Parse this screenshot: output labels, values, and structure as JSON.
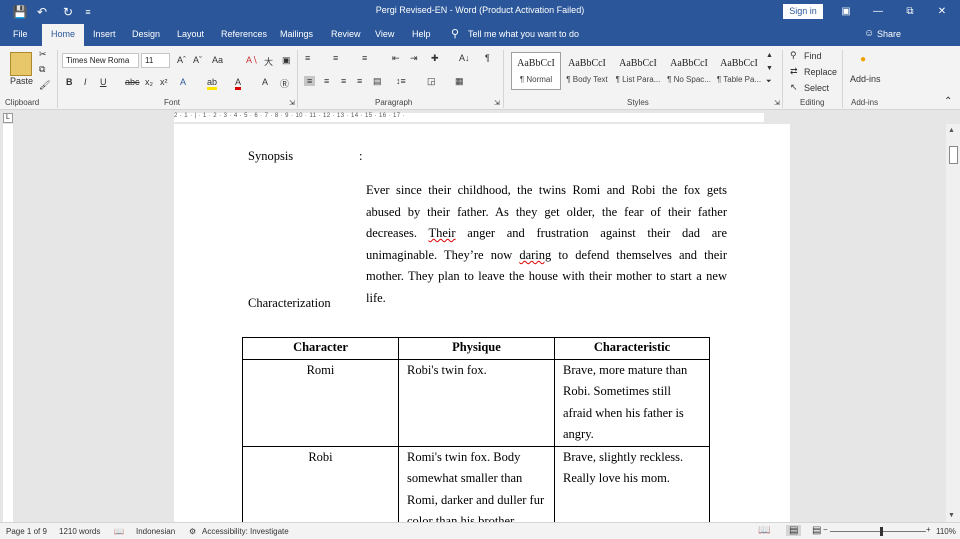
{
  "window": {
    "title": "Pergi Revised-EN  -  Word (Product Activation Failed)",
    "sign_in": "Sign in"
  },
  "tabs": [
    "File",
    "Home",
    "Insert",
    "Design",
    "Layout",
    "References",
    "Mailings",
    "Review",
    "View",
    "Help"
  ],
  "tell_me": "Tell me what you want to do",
  "share": "Share",
  "ribbon": {
    "clipboard": {
      "paste": "Paste",
      "label": "Clipboard"
    },
    "font": {
      "name": "Times New Roma",
      "size": "11",
      "label": "Font"
    },
    "paragraph": {
      "label": "Paragraph"
    },
    "styles": {
      "label": "Styles",
      "items": [
        {
          "preview": "AaBbCcI",
          "name": "¶ Normal"
        },
        {
          "preview": "AaBbCcI",
          "name": "¶ Body Text"
        },
        {
          "preview": "AaBbCcI",
          "name": "¶ List Para..."
        },
        {
          "preview": "AaBbCcI",
          "name": "¶ No Spac..."
        },
        {
          "preview": "AaBbCcI",
          "name": "¶ Table Pa..."
        }
      ]
    },
    "editing": {
      "find": "Find",
      "replace": "Replace",
      "select": "Select",
      "label": "Editing"
    },
    "addins": {
      "button": "Add-ins",
      "label": "Add-ins"
    }
  },
  "ruler": {
    "marks": "2 · 1 · | · 1 · 2 · 3 · 4 · 5 · 6 · 7 · 8 · 9 · 10 · 11 · 12 · 13 · 14 · 15 · 16 · 17 ·"
  },
  "document": {
    "synopsis_heading": "Synopsis",
    "synopsis_colon": ":",
    "synopsis_parts": [
      "Ever since their childhood, the twins Romi and Robi the fox gets abused by their father. As they get older, the fear of their father decreases. ",
      "Their",
      " anger and frustration against their dad are unimaginable. They’re now ",
      "daring",
      " to defend themselves and their mother. They plan to leave the house with their mother to start a new life."
    ],
    "characterization_heading": "Characterization",
    "table": {
      "headers": [
        "Character",
        "Physique",
        "Characteristic"
      ],
      "rows": [
        [
          "Romi",
          "Robi's twin fox.",
          "Brave, more mature than Robi. Sometimes still afraid when his father is angry."
        ],
        [
          "Robi",
          "Romi's twin fox. Body somewhat smaller than Romi, darker and duller fur color than his brother",
          "Brave, slightly reckless. Really love his mom."
        ]
      ]
    }
  },
  "status": {
    "page": "Page 1 of 9",
    "words": "1210 words",
    "language": "Indonesian",
    "accessibility": "Accessibility: Investigate",
    "zoom": "110%"
  }
}
